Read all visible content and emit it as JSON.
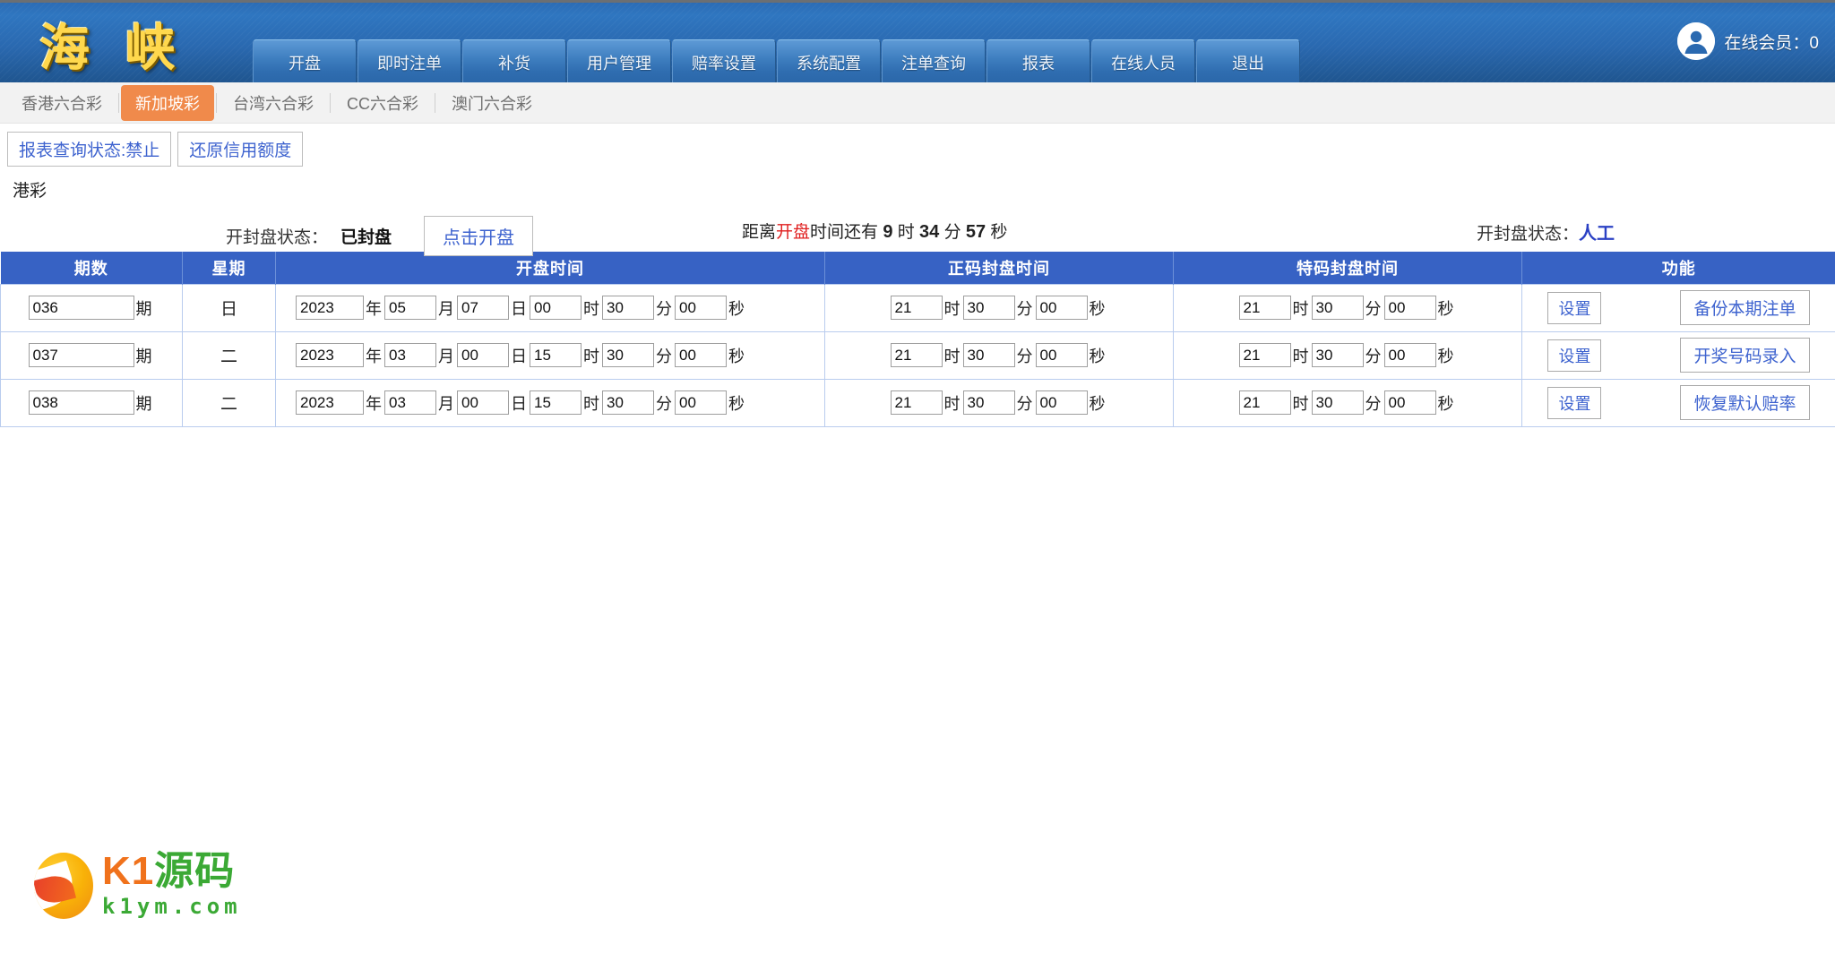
{
  "header": {
    "brand": "海 峡",
    "user_label": "在线会员：0",
    "avatar_icon": "user-avatar-icon",
    "nav_items": [
      {
        "label": "开盘"
      },
      {
        "label": "即时注单"
      },
      {
        "label": "补货"
      },
      {
        "label": "用户管理"
      },
      {
        "label": "赔率设置"
      },
      {
        "label": "系统配置"
      },
      {
        "label": "注单查询"
      },
      {
        "label": "报表"
      },
      {
        "label": "在线人员"
      },
      {
        "label": "退出"
      }
    ]
  },
  "lottery_tabs": [
    {
      "label": "香港六合彩",
      "active": false
    },
    {
      "label": "新加坡彩",
      "active": true
    },
    {
      "label": "台湾六合彩",
      "active": false
    },
    {
      "label": "CC六合彩",
      "active": false
    },
    {
      "label": "澳门六合彩",
      "active": false
    }
  ],
  "toolbar": {
    "report_status_label": "报表查询状态:禁止",
    "restore_credit_label": "还原信用额度"
  },
  "page_subtitle": "港彩",
  "status": {
    "board_state_label": "开封盘状态：",
    "board_state_value": "已封盘",
    "open_button_label": "点击开盘",
    "countdown_prefix": "距离",
    "countdown_highlight": "开盘",
    "countdown_middle": "时间还有",
    "countdown_hours": "9",
    "countdown_hours_unit": "时",
    "countdown_minutes": "34",
    "countdown_minutes_unit": "分",
    "countdown_seconds": "57",
    "countdown_seconds_unit": "秒",
    "mode_label": "开封盘状态：",
    "mode_value": "人工"
  },
  "table": {
    "headers": [
      "期数",
      "星期",
      "开盘时间",
      "正码封盘时间",
      "特码封盘时间",
      "功能"
    ],
    "units": {
      "issue": "期",
      "year": "年",
      "month": "月",
      "day": "日",
      "hour": "时",
      "minute": "分",
      "second": "秒"
    },
    "rows": [
      {
        "issue": "036",
        "weekday": "日",
        "open": {
          "year": "2023",
          "month": "05",
          "day": "07",
          "hour": "00",
          "minute": "30",
          "second": "00"
        },
        "normal_close": {
          "hour": "21",
          "minute": "30",
          "second": "00"
        },
        "special_close": {
          "hour": "21",
          "minute": "30",
          "second": "00"
        },
        "setting_label": "设置",
        "action_label": "备份本期注单"
      },
      {
        "issue": "037",
        "weekday": "二",
        "open": {
          "year": "2023",
          "month": "03",
          "day": "00",
          "hour": "15",
          "minute": "30",
          "second": "00"
        },
        "normal_close": {
          "hour": "21",
          "minute": "30",
          "second": "00"
        },
        "special_close": {
          "hour": "21",
          "minute": "30",
          "second": "00"
        },
        "setting_label": "设置",
        "action_label": "开奖号码录入"
      },
      {
        "issue": "038",
        "weekday": "二",
        "open": {
          "year": "2023",
          "month": "03",
          "day": "00",
          "hour": "15",
          "minute": "30",
          "second": "00"
        },
        "normal_close": {
          "hour": "21",
          "minute": "30",
          "second": "00"
        },
        "special_close": {
          "hour": "21",
          "minute": "30",
          "second": "00"
        },
        "setting_label": "设置",
        "action_label": "恢复默认赔率"
      }
    ]
  },
  "footer_logo": {
    "main_k1": "K1",
    "main_ym": "源码",
    "sub": "k1ym.com"
  },
  "colors": {
    "header_blue": "#2a69b0",
    "table_header_blue": "#3762c4",
    "active_tab_orange": "#f08a4b",
    "link_blue": "#3e63cf",
    "alert_red": "#e02020",
    "brand_yellow": "#ffd84d"
  }
}
